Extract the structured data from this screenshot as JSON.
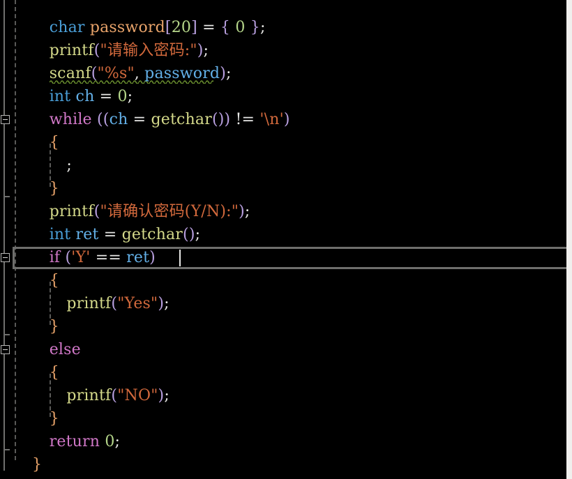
{
  "editor": {
    "app_kind": "code-editor",
    "language": "C",
    "theme": {
      "background": "#000000",
      "page_edge": "#f0efed",
      "gutter_line": "#70706e",
      "indent_guide": "#5a5a58",
      "current_line_border": "#6e6e6c",
      "caret": "#e8e8e6",
      "squiggle": "#6a8f2e",
      "type_keyword": "#4a9fd8",
      "control_keyword": "#d178c8",
      "function": "#d4d98a",
      "variable_decl": "#e8a36a",
      "variable_use": "#63b0e8",
      "number": "#b5d68a",
      "string": "#d2693c",
      "punctuation": "#b9a0e0",
      "brace": "#e8a36a",
      "operator": "#e8e8e6"
    },
    "font_size_px": 22,
    "line_height_px": 33,
    "caret": {
      "line_index": 12,
      "after_text": "ret)"
    }
  },
  "code": {
    "lines": [
      {
        "indent": 2,
        "tokens": [
          {
            "t": "char",
            "c": "tok-type"
          },
          {
            "t": " ",
            "c": "tok-plain"
          },
          {
            "t": "password",
            "c": "tok-var"
          },
          {
            "t": "[",
            "c": "tok-punct"
          },
          {
            "t": "20",
            "c": "tok-num"
          },
          {
            "t": "]",
            "c": "tok-punct"
          },
          {
            "t": " = ",
            "c": "tok-op"
          },
          {
            "t": "{",
            "c": "tok-punct"
          },
          {
            "t": " ",
            "c": "tok-plain"
          },
          {
            "t": "0",
            "c": "tok-num"
          },
          {
            "t": " ",
            "c": "tok-plain"
          },
          {
            "t": "}",
            "c": "tok-punct"
          },
          {
            "t": ";",
            "c": "tok-op"
          }
        ]
      },
      {
        "indent": 2,
        "tokens": [
          {
            "t": "printf",
            "c": "tok-fn"
          },
          {
            "t": "(",
            "c": "tok-punct"
          },
          {
            "t": "\"请输入密码:\"",
            "c": "tok-str"
          },
          {
            "t": ")",
            "c": "tok-punct"
          },
          {
            "t": ";",
            "c": "tok-op"
          }
        ]
      },
      {
        "indent": 2,
        "squiggle": true,
        "tokens": [
          {
            "t": "scanf",
            "c": "tok-fn"
          },
          {
            "t": "(",
            "c": "tok-punct"
          },
          {
            "t": "\"%s\"",
            "c": "tok-str"
          },
          {
            "t": ", ",
            "c": "tok-op"
          },
          {
            "t": "password",
            "c": "tok-varblue"
          },
          {
            "t": ")",
            "c": "tok-punct"
          },
          {
            "t": ";",
            "c": "tok-op"
          }
        ]
      },
      {
        "indent": 2,
        "tokens": [
          {
            "t": "int",
            "c": "tok-type"
          },
          {
            "t": " ",
            "c": "tok-plain"
          },
          {
            "t": "ch",
            "c": "tok-varblue"
          },
          {
            "t": " = ",
            "c": "tok-op"
          },
          {
            "t": "0",
            "c": "tok-num"
          },
          {
            "t": ";",
            "c": "tok-op"
          }
        ]
      },
      {
        "indent": 2,
        "tokens": [
          {
            "t": "while",
            "c": "tok-ctrl"
          },
          {
            "t": " ",
            "c": "tok-plain"
          },
          {
            "t": "((",
            "c": "tok-punct"
          },
          {
            "t": "ch",
            "c": "tok-varblue"
          },
          {
            "t": " = ",
            "c": "tok-op"
          },
          {
            "t": "getchar",
            "c": "tok-fn"
          },
          {
            "t": "()) ",
            "c": "tok-punct"
          },
          {
            "t": "!= ",
            "c": "tok-op"
          },
          {
            "t": "'\\n'",
            "c": "tok-str"
          },
          {
            "t": ")",
            "c": "tok-punct"
          }
        ]
      },
      {
        "indent": 2,
        "tokens": [
          {
            "t": "{",
            "c": "tok-brace"
          }
        ]
      },
      {
        "indent": 4,
        "tokens": [
          {
            "t": ";",
            "c": "tok-op"
          }
        ]
      },
      {
        "indent": 2,
        "tokens": [
          {
            "t": "}",
            "c": "tok-brace"
          }
        ]
      },
      {
        "indent": 2,
        "tokens": [
          {
            "t": "printf",
            "c": "tok-fn"
          },
          {
            "t": "(",
            "c": "tok-punct"
          },
          {
            "t": "\"请确认密码(Y/N):\"",
            "c": "tok-str"
          },
          {
            "t": ")",
            "c": "tok-punct"
          },
          {
            "t": ";",
            "c": "tok-op"
          }
        ]
      },
      {
        "indent": 2,
        "tokens": [
          {
            "t": "int",
            "c": "tok-type"
          },
          {
            "t": " ",
            "c": "tok-plain"
          },
          {
            "t": "ret",
            "c": "tok-varblue"
          },
          {
            "t": " = ",
            "c": "tok-op"
          },
          {
            "t": "getchar",
            "c": "tok-fn"
          },
          {
            "t": "()",
            "c": "tok-punct"
          },
          {
            "t": ";",
            "c": "tok-op"
          }
        ]
      },
      {
        "indent": 2,
        "current": true,
        "tokens": [
          {
            "t": "if",
            "c": "tok-ctrl"
          },
          {
            "t": " ",
            "c": "tok-plain"
          },
          {
            "t": "(",
            "c": "tok-punct"
          },
          {
            "t": "'Y'",
            "c": "tok-str"
          },
          {
            "t": " == ",
            "c": "tok-op"
          },
          {
            "t": "ret",
            "c": "tok-varblue"
          },
          {
            "t": ")",
            "c": "tok-punct"
          }
        ]
      },
      {
        "indent": 2,
        "tokens": [
          {
            "t": "{",
            "c": "tok-brace"
          }
        ]
      },
      {
        "indent": 4,
        "tokens": [
          {
            "t": "printf",
            "c": "tok-fn"
          },
          {
            "t": "(",
            "c": "tok-punct"
          },
          {
            "t": "\"Yes\"",
            "c": "tok-str"
          },
          {
            "t": ")",
            "c": "tok-punct"
          },
          {
            "t": ";",
            "c": "tok-op"
          }
        ]
      },
      {
        "indent": 2,
        "tokens": [
          {
            "t": "}",
            "c": "tok-brace"
          }
        ]
      },
      {
        "indent": 2,
        "tokens": [
          {
            "t": "else",
            "c": "tok-ctrl"
          }
        ]
      },
      {
        "indent": 2,
        "tokens": [
          {
            "t": "{",
            "c": "tok-brace"
          }
        ]
      },
      {
        "indent": 4,
        "tokens": [
          {
            "t": "printf",
            "c": "tok-fn"
          },
          {
            "t": "(",
            "c": "tok-punct"
          },
          {
            "t": "\"NO\"",
            "c": "tok-str"
          },
          {
            "t": ")",
            "c": "tok-punct"
          },
          {
            "t": ";",
            "c": "tok-op"
          }
        ]
      },
      {
        "indent": 2,
        "tokens": [
          {
            "t": "}",
            "c": "tok-brace"
          }
        ]
      },
      {
        "indent": 2,
        "tokens": [
          {
            "t": "return",
            "c": "tok-ctrl"
          },
          {
            "t": " ",
            "c": "tok-plain"
          },
          {
            "t": "0",
            "c": "tok-num"
          },
          {
            "t": ";",
            "c": "tok-op"
          }
        ]
      },
      {
        "indent": 0,
        "tokens": [
          {
            "t": "}",
            "c": "tok-brace"
          }
        ]
      }
    ],
    "plain_text": [
      "    char password[20] = { 0 };",
      "    printf(\"请输入密码:\");",
      "    scanf(\"%s\", password);",
      "    int ch = 0;",
      "    while ((ch = getchar()) != '\\n')",
      "    {",
      "        ;",
      "    }",
      "    printf(\"请确认密码(Y/N):\");",
      "    int ret = getchar();",
      "    if ('Y' == ret)",
      "    {",
      "        printf(\"Yes\");",
      "    }",
      "    else",
      "    {",
      "        printf(\"NO\");",
      "    }",
      "    return 0;",
      "}"
    ]
  },
  "gutter": {
    "fold_boxes": [
      {
        "label": "-",
        "line_index": 4,
        "block": "while-loop"
      },
      {
        "label": "-",
        "line_index": 10,
        "block": "if-branch"
      },
      {
        "label": "-",
        "line_index": 14,
        "block": "else-branch"
      }
    ],
    "fold_end_ticks": [
      {
        "line_index": 7
      },
      {
        "line_index": 13
      },
      {
        "line_index": 18
      }
    ]
  }
}
